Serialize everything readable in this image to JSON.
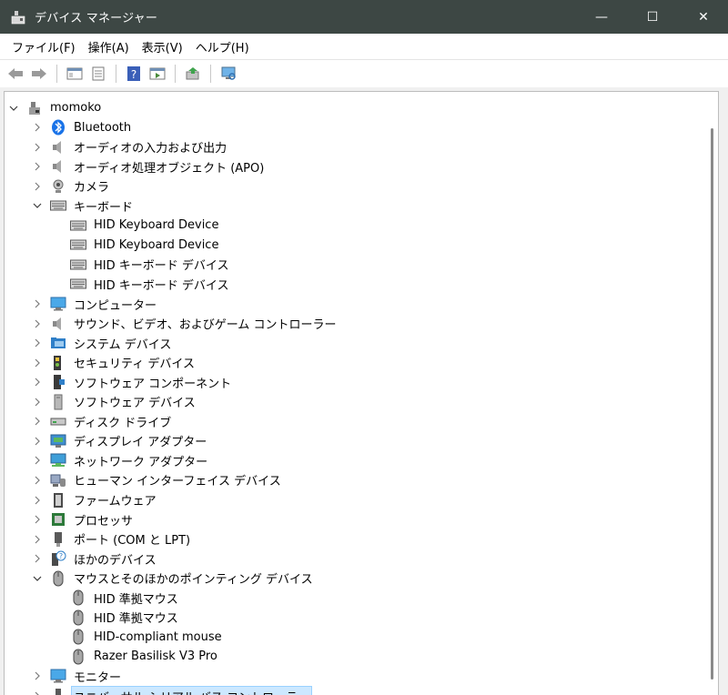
{
  "window": {
    "title": "デバイス マネージャー",
    "controls": {
      "minimize": "—",
      "maximize": "☐",
      "close": "✕"
    }
  },
  "menu": [
    "ファイル(F)",
    "操作(A)",
    "表示(V)",
    "ヘルプ(H)"
  ],
  "toolbar": [
    "back-arrow-icon",
    "forward-arrow-icon",
    "show-hide-tree-icon",
    "properties-icon",
    "help-icon",
    "action-pane-icon",
    "update-driver-icon",
    "scan-hardware-icon"
  ],
  "tree": [
    {
      "label": "momoko",
      "level": 0,
      "state": "expanded",
      "icon": "computer-root-icon"
    },
    {
      "label": "Bluetooth",
      "level": 1,
      "state": "collapsed",
      "icon": "bluetooth-icon"
    },
    {
      "label": "オーディオの入力および出力",
      "level": 1,
      "state": "collapsed",
      "icon": "speaker-icon"
    },
    {
      "label": "オーディオ処理オブジェクト (APO)",
      "level": 1,
      "state": "collapsed",
      "icon": "speaker-icon"
    },
    {
      "label": "カメラ",
      "level": 1,
      "state": "collapsed",
      "icon": "camera-icon"
    },
    {
      "label": "キーボード",
      "level": 1,
      "state": "expanded",
      "icon": "keyboard-icon"
    },
    {
      "label": "HID Keyboard Device",
      "level": 2,
      "state": "leaf",
      "icon": "keyboard-icon"
    },
    {
      "label": "HID Keyboard Device",
      "level": 2,
      "state": "leaf",
      "icon": "keyboard-icon"
    },
    {
      "label": "HID キーボード デバイス",
      "level": 2,
      "state": "leaf",
      "icon": "keyboard-icon"
    },
    {
      "label": "HID キーボード デバイス",
      "level": 2,
      "state": "leaf",
      "icon": "keyboard-icon"
    },
    {
      "label": "コンピューター",
      "level": 1,
      "state": "collapsed",
      "icon": "monitor-icon"
    },
    {
      "label": "サウンド、ビデオ、およびゲーム コントローラー",
      "level": 1,
      "state": "collapsed",
      "icon": "speaker-icon"
    },
    {
      "label": "システム デバイス",
      "level": 1,
      "state": "collapsed",
      "icon": "folder-icon"
    },
    {
      "label": "セキュリティ デバイス",
      "level": 1,
      "state": "collapsed",
      "icon": "security-icon"
    },
    {
      "label": "ソフトウェア コンポーネント",
      "level": 1,
      "state": "collapsed",
      "icon": "component-icon"
    },
    {
      "label": "ソフトウェア デバイス",
      "level": 1,
      "state": "collapsed",
      "icon": "software-device-icon"
    },
    {
      "label": "ディスク ドライブ",
      "level": 1,
      "state": "collapsed",
      "icon": "disk-icon"
    },
    {
      "label": "ディスプレイ アダプター",
      "level": 1,
      "state": "collapsed",
      "icon": "display-adapter-icon"
    },
    {
      "label": "ネットワーク アダプター",
      "level": 1,
      "state": "collapsed",
      "icon": "network-icon"
    },
    {
      "label": "ヒューマン インターフェイス デバイス",
      "level": 1,
      "state": "collapsed",
      "icon": "hid-icon"
    },
    {
      "label": "ファームウェア",
      "level": 1,
      "state": "collapsed",
      "icon": "firmware-icon"
    },
    {
      "label": "プロセッサ",
      "level": 1,
      "state": "collapsed",
      "icon": "processor-icon"
    },
    {
      "label": "ポート (COM と LPT)",
      "level": 1,
      "state": "collapsed",
      "icon": "port-icon"
    },
    {
      "label": "ほかのデバイス",
      "level": 1,
      "state": "collapsed",
      "icon": "unknown-device-icon"
    },
    {
      "label": "マウスとそのほかのポインティング デバイス",
      "level": 1,
      "state": "expanded",
      "icon": "mouse-icon"
    },
    {
      "label": "HID 準拠マウス",
      "level": 2,
      "state": "leaf",
      "icon": "mouse-icon"
    },
    {
      "label": "HID 準拠マウス",
      "level": 2,
      "state": "leaf",
      "icon": "mouse-icon"
    },
    {
      "label": "HID-compliant mouse",
      "level": 2,
      "state": "leaf",
      "icon": "mouse-icon"
    },
    {
      "label": "Razer Basilisk V3 Pro",
      "level": 2,
      "state": "leaf",
      "icon": "mouse-icon"
    },
    {
      "label": "モニター",
      "level": 1,
      "state": "collapsed",
      "icon": "monitor-icon"
    },
    {
      "label": "ユニバーサル シリアル バス コントローラー",
      "level": 1,
      "state": "collapsed",
      "icon": "usb-icon",
      "selected": true
    }
  ],
  "colors": {
    "titlebar": "#3d4744",
    "selection": "#cce8ff",
    "selection_border": "#99d1ff"
  }
}
